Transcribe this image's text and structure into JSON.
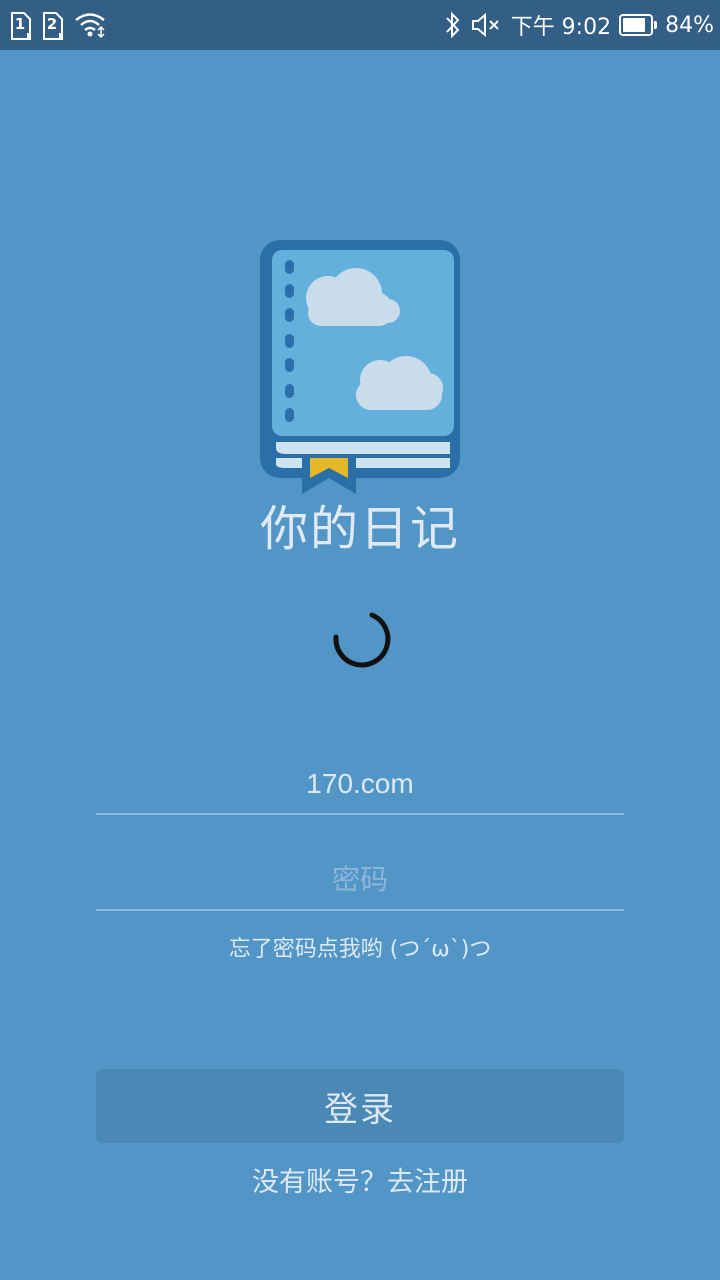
{
  "status_bar": {
    "sim1": "1",
    "sim2": "2",
    "time": "下午 9:02",
    "battery_percent": "84%",
    "battery_level": 0.84,
    "icons": [
      "sim-1-icon",
      "sim-2-icon",
      "wifi-icon",
      "bluetooth-icon",
      "mute-icon",
      "battery-icon"
    ]
  },
  "app": {
    "title": "你的日记",
    "logo_icon": "diary-book-icon"
  },
  "login": {
    "username_value": "170.com",
    "password_placeholder": "密码",
    "forgot_text": "忘了密码点我哟 (つ´ω`)つ",
    "login_button": "登录",
    "register_text": "没有账号？去注册"
  },
  "colors": {
    "background": "#5295c7",
    "status_bar": "#335e85",
    "button": "#4a88b6",
    "text": "#dde8f2"
  }
}
